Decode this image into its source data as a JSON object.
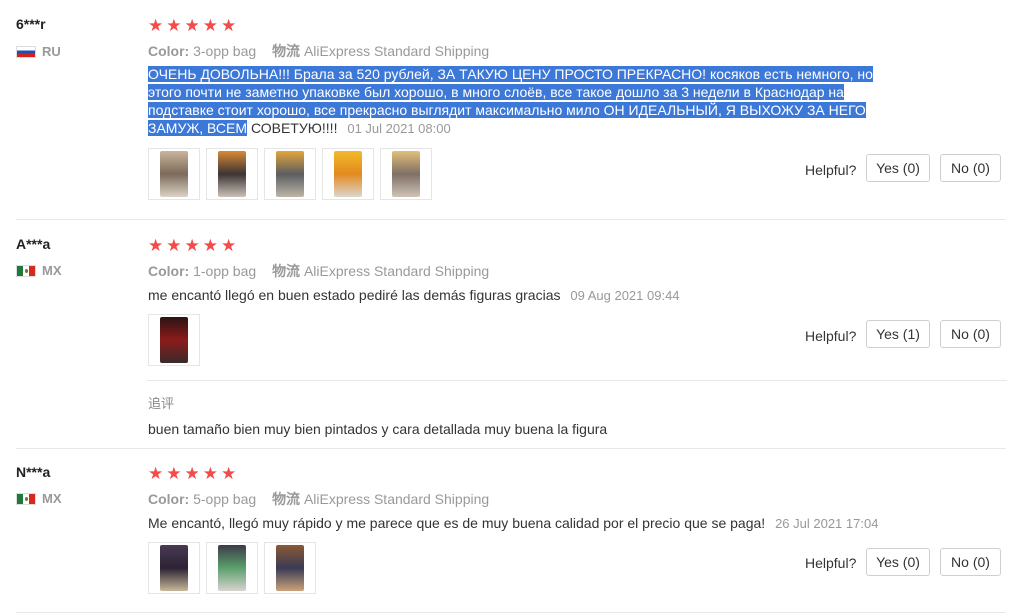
{
  "reviews": [
    {
      "user": "6***r",
      "country": "RU",
      "stars": 5,
      "color_label": "Color:",
      "color_value": "3-opp bag",
      "shipping_label": "物流",
      "shipping_value": "AliExpress Standard Shipping",
      "text_highlighted": "ОЧЕНЬ ДОВОЛЬНА!!! Брала за 520 рублей, ЗА ТАКУЮ ЦЕНУ ПРОСТО ПРЕКРАСНО! косяков есть немного, но этого почти не заметно упаковке был хорошо, в много слоёв, все такое дошло за 3 недели в Краснодар на подставке стоит хорошо, все прекрасно выглядит максимально мило ОН ИДЕАЛЬНЫЙ, Я ВЫХОЖУ ЗА НЕГО ЗАМУЖ, ВСЕМ",
      "text_rest": "СОВЕТУЮ!!!!",
      "date": "01 Jul 2021 08:00",
      "helpful_label": "Helpful?",
      "yes_label": "Yes (0)",
      "no_label": "No (0)"
    },
    {
      "user": "A***a",
      "country": "MX",
      "stars": 5,
      "color_label": "Color:",
      "color_value": "1-opp bag",
      "shipping_label": "物流",
      "shipping_value": "AliExpress Standard Shipping",
      "text": "me encantó llegó en buen estado pediré las demás figuras gracias",
      "date": "09 Aug 2021 09:44",
      "helpful_label": "Helpful?",
      "yes_label": "Yes (1)",
      "no_label": "No (0)",
      "followup_label": "追评",
      "followup_text": "buen tamaño bien muy bien pintados y cara detallada muy buena la figura"
    },
    {
      "user": "N***a",
      "country": "MX",
      "stars": 5,
      "color_label": "Color:",
      "color_value": "5-opp bag",
      "shipping_label": "物流",
      "shipping_value": "AliExpress Standard Shipping",
      "text": "Me encantó, llegó muy rápido y me parece que es de muy buena calidad por el precio que se paga!",
      "date": "26 Jul 2021 17:04",
      "helpful_label": "Helpful?",
      "yes_label": "Yes (0)",
      "no_label": "No (0)"
    }
  ],
  "icons": {
    "star": "★",
    "flag_ru": "russia-flag-icon",
    "flag_mx": "mexico-flag-icon"
  },
  "colors": {
    "star": "#f44b4b",
    "highlight": "#3c78d8",
    "muted": "#999999"
  }
}
